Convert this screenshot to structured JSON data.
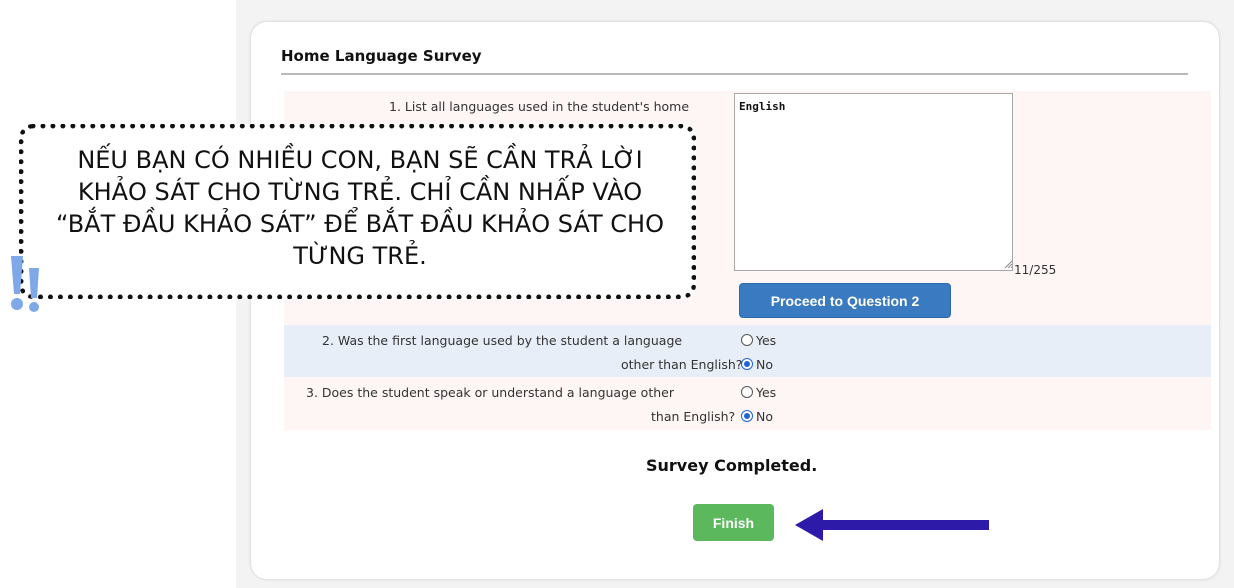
{
  "survey": {
    "title": "Home Language Survey",
    "q1": {
      "text": "1. List all languages used in the student's home",
      "answer": "English",
      "char_count": "11/255",
      "proceed_label": "Proceed to Question 2"
    },
    "q2": {
      "line1": "2. Was the first language used by the student a language",
      "line2": "other than English?",
      "option_yes": "Yes",
      "option_no": "No",
      "selected": "No"
    },
    "q3": {
      "line1": "3. Does the student speak or understand a language other",
      "line2": "than English?",
      "option_yes": "Yes",
      "option_no": "No",
      "selected": "No"
    },
    "completed_text": "Survey Completed.",
    "finish_label": "Finish"
  },
  "callout": {
    "line1": "NẾU BẠN CÓ NHIỀU CON, BẠN SẼ CẦN TRẢ LỜI",
    "line2": "KHẢO SÁT CHO TỪNG TRẺ. CHỈ CẦN NHẤP VÀO",
    "line3": "“BẮT ĐẦU KHẢO SÁT” ĐỂ BẮT ĐẦU KHẢO SÁT CHO",
    "line4": "TỪNG TRẺ."
  },
  "colors": {
    "proceed_button": "#3a7ac0",
    "finish_button": "#5cb85c",
    "arrow": "#2e1aa8",
    "exclaim": "#7fa8e8"
  },
  "icons": {
    "arrow": "left-arrow-icon",
    "exclaim": "double-exclamation-icon",
    "resize": "resize-grip-icon"
  }
}
